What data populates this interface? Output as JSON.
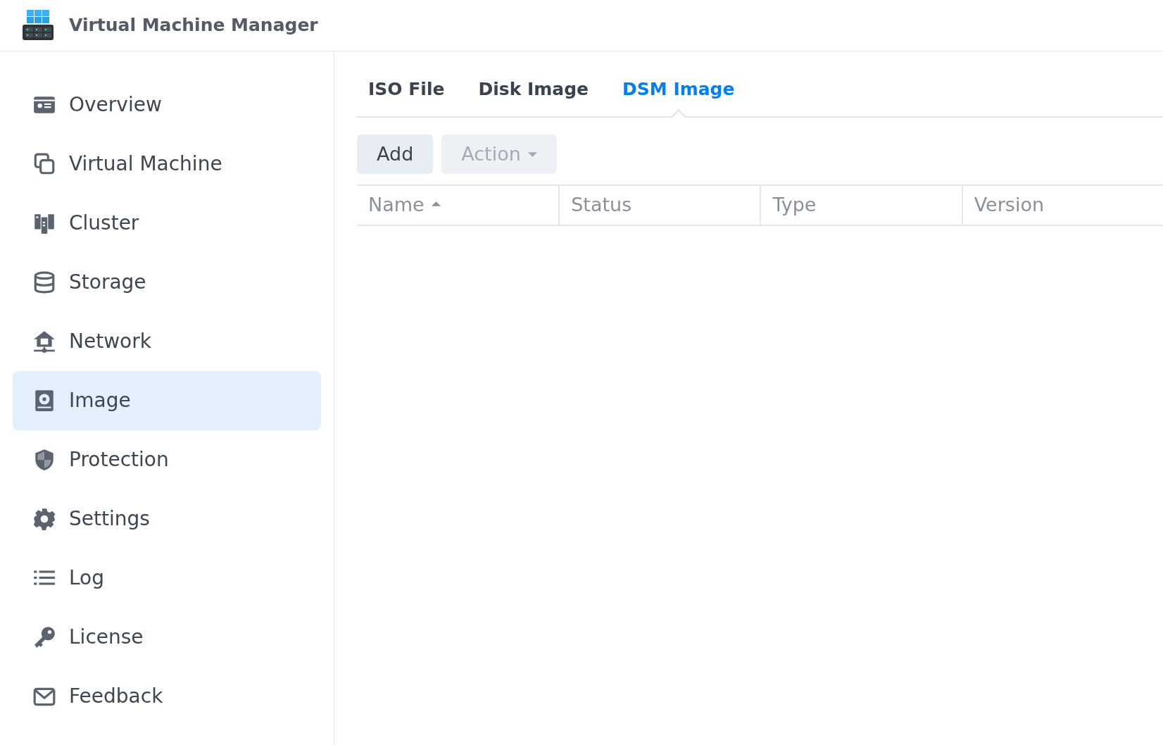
{
  "app": {
    "title": "Virtual Machine Manager"
  },
  "sidebar": {
    "items": [
      {
        "label": "Overview",
        "selected": false
      },
      {
        "label": "Virtual Machine",
        "selected": false
      },
      {
        "label": "Cluster",
        "selected": false
      },
      {
        "label": "Storage",
        "selected": false
      },
      {
        "label": "Network",
        "selected": false
      },
      {
        "label": "Image",
        "selected": true
      },
      {
        "label": "Protection",
        "selected": false
      },
      {
        "label": "Settings",
        "selected": false
      },
      {
        "label": "Log",
        "selected": false
      },
      {
        "label": "License",
        "selected": false
      },
      {
        "label": "Feedback",
        "selected": false
      }
    ]
  },
  "tabs": [
    {
      "label": "ISO File",
      "selected": false
    },
    {
      "label": "Disk Image",
      "selected": false
    },
    {
      "label": "DSM Image",
      "selected": true
    }
  ],
  "toolbar": {
    "buttons": [
      {
        "label": "Add",
        "disabled": false,
        "dropdown": false
      },
      {
        "label": "Action",
        "disabled": true,
        "dropdown": true
      }
    ]
  },
  "table": {
    "columns": [
      {
        "label": "Name",
        "sorted": true
      },
      {
        "label": "Status",
        "sorted": false
      },
      {
        "label": "Type",
        "sorted": false
      },
      {
        "label": "Version",
        "sorted": false
      }
    ]
  }
}
